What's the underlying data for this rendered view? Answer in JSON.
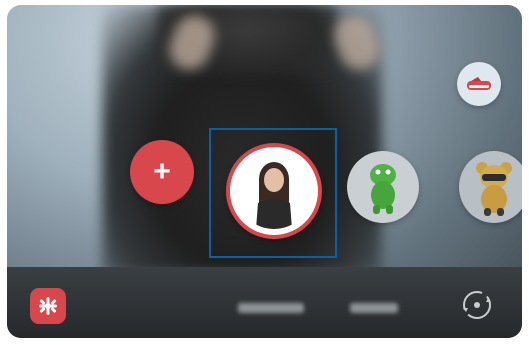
{
  "screen": {
    "add_label": "+",
    "emoji_options": [
      {
        "name": "my-emoji-avatar",
        "selected": true
      },
      {
        "name": "dinosaur-emoji"
      },
      {
        "name": "bear-emoji"
      }
    ],
    "shoe_icon": "shoe-icon",
    "sticker_icon": "sticker-icon",
    "switch_icon": "switch-camera-icon",
    "colors": {
      "accent": "#d7474b",
      "selection_frame": "#0a5fa6"
    }
  }
}
